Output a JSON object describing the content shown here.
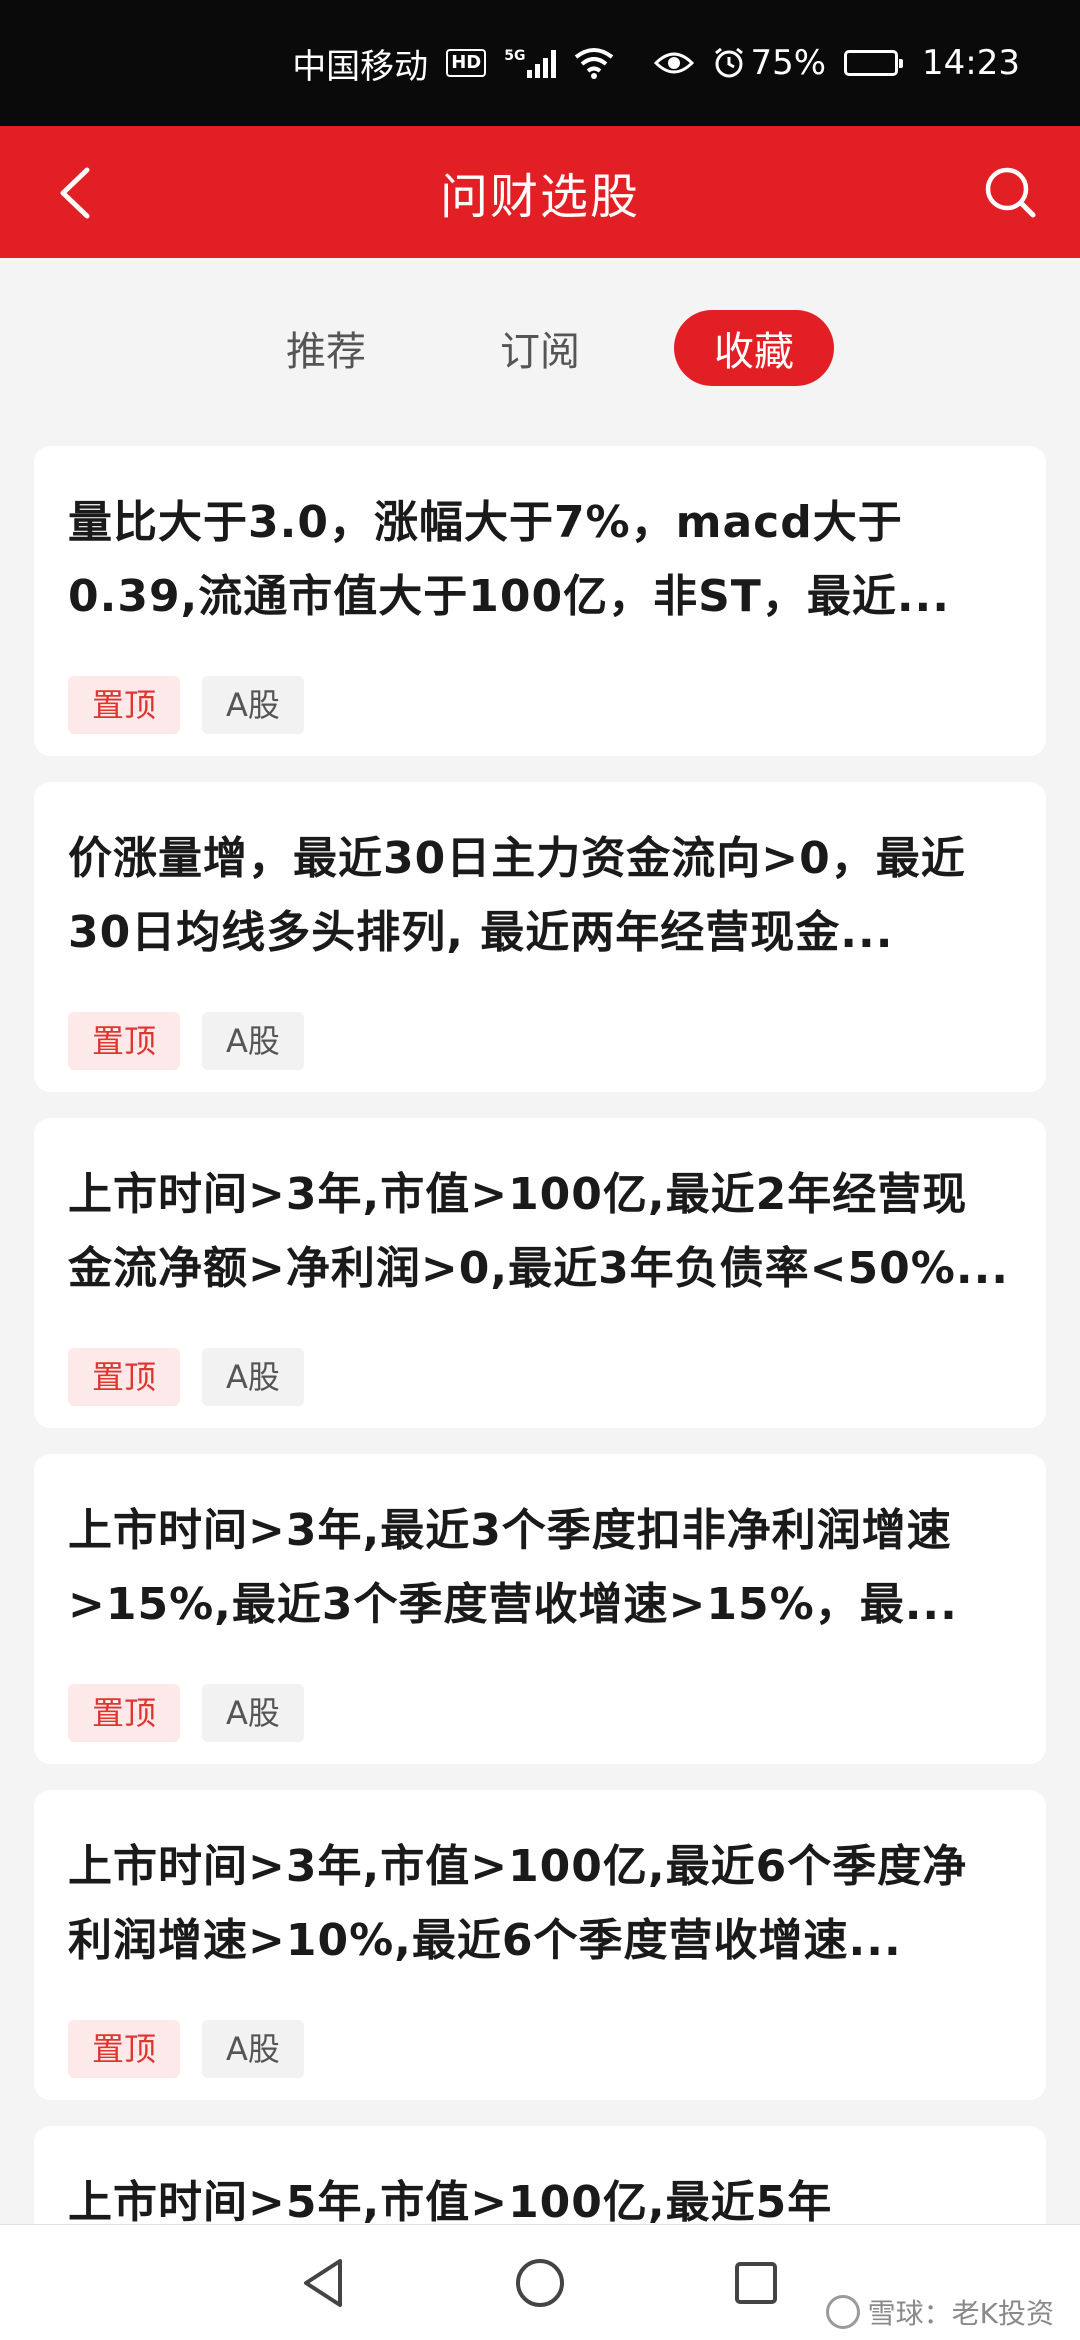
{
  "status_bar": {
    "carrier": "中国移动",
    "hd_badge": "HD",
    "network": "5G",
    "battery_text": "75%",
    "battery_level": 0.75,
    "time": "14:23"
  },
  "header": {
    "title": "问财选股"
  },
  "tabs": [
    {
      "label": "推荐",
      "active": false
    },
    {
      "label": "订阅",
      "active": false
    },
    {
      "label": "收藏",
      "active": true
    }
  ],
  "cards": [
    {
      "text": "量比大于3.0，涨幅大于7%，macd大于0.39,流通市值大于100亿，非ST，最近...",
      "tag_pin": "置顶",
      "tag_market": "A股"
    },
    {
      "text": "价涨量增，最近30日主力资金流向>0，最近30日均线多头排列, 最近两年经营现金...",
      "tag_pin": "置顶",
      "tag_market": "A股"
    },
    {
      "text": "上市时间>3年,市值>100亿,最近2年经营现金流净额>净利润>0,最近3年负债率<50%...",
      "tag_pin": "置顶",
      "tag_market": "A股"
    },
    {
      "text": "上市时间>3年,最近3个季度扣非净利润增速>15%,最近3个季度营收增速>15%，最...",
      "tag_pin": "置顶",
      "tag_market": "A股"
    },
    {
      "text": "上市时间>3年,市值>100亿,最近6个季度净利润增速>10%,最近6个季度营收增速...",
      "tag_pin": "置顶",
      "tag_market": "A股"
    }
  ],
  "partial_card": {
    "text": "上市时间>5年,市值>100亿,最近5年"
  },
  "watermark": "雪球：老K投资",
  "colors": {
    "brand_red": "#e21f24",
    "pin_tag_bg": "#fde9e9",
    "pin_tag_text": "#e0342f"
  }
}
